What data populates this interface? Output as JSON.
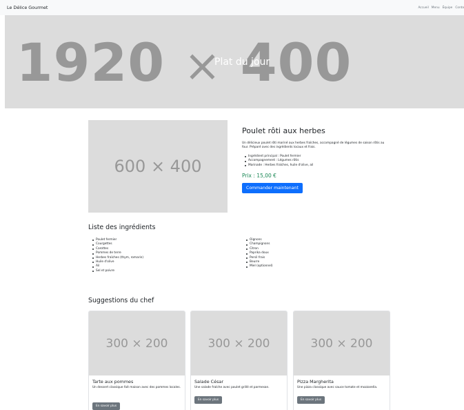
{
  "navbar": {
    "brand": "Le Délice Gourmet",
    "links": [
      "Accueil",
      "Menu",
      "Équipe",
      "Conta"
    ]
  },
  "hero": {
    "placeholder_w": "1920",
    "placeholder_x": "×",
    "placeholder_h": "400",
    "title": "Plat du jour"
  },
  "dish": {
    "image_placeholder": "600 × 400",
    "title": "Poulet rôti aux herbes",
    "description": "Un délicieux poulet rôti mariné aux herbes fraîches, accompagné de légumes de saison rôtis au four. Préparé avec des ingrédients locaux et frais.",
    "details": [
      "Ingrédient principal : Poulet fermier",
      "Accompagnement : Légumes rôtis",
      "Marinade : Herbes fraîches, huile d'olive, ail"
    ],
    "price": "Prix : 15,00 €",
    "order_label": "Commander maintenant"
  },
  "ingredients": {
    "title": "Liste des ingrédients",
    "left": [
      "Poulet fermier",
      "Courgettes",
      "Carottes",
      "Pommes de terre",
      "Herbes fraîches (thym, romarin)",
      "Huile d'olive",
      "Ail",
      "Sel et poivre"
    ],
    "right": [
      "Oignons",
      "Champignons",
      "Citron",
      "Paprika doux",
      "Persil frais",
      "Beurre",
      "Miel (optionnel)"
    ]
  },
  "suggestions": {
    "title": "Suggestions du chef",
    "cards": [
      {
        "image_placeholder": "300 × 200",
        "title": "Tarte aux pommes",
        "text": "Un dessert classique fait maison avec des pommes locales.",
        "button": "En savoir plus"
      },
      {
        "image_placeholder": "300 × 200",
        "title": "Salade César",
        "text": "Une salade fraîche avec poulet grillé et parmesan.",
        "button": "En savoir plus"
      },
      {
        "image_placeholder": "300 × 200",
        "title": "Pizza Margherita",
        "text": "Une pizza classique avec sauce tomate et mozzarella.",
        "button": "En savoir plus"
      }
    ]
  },
  "colors": {
    "primary": "#0d6efd",
    "secondary": "#6c757d",
    "success": "#198754",
    "placeholder_bg": "#dcdcdc",
    "placeholder_text": "#989898"
  }
}
